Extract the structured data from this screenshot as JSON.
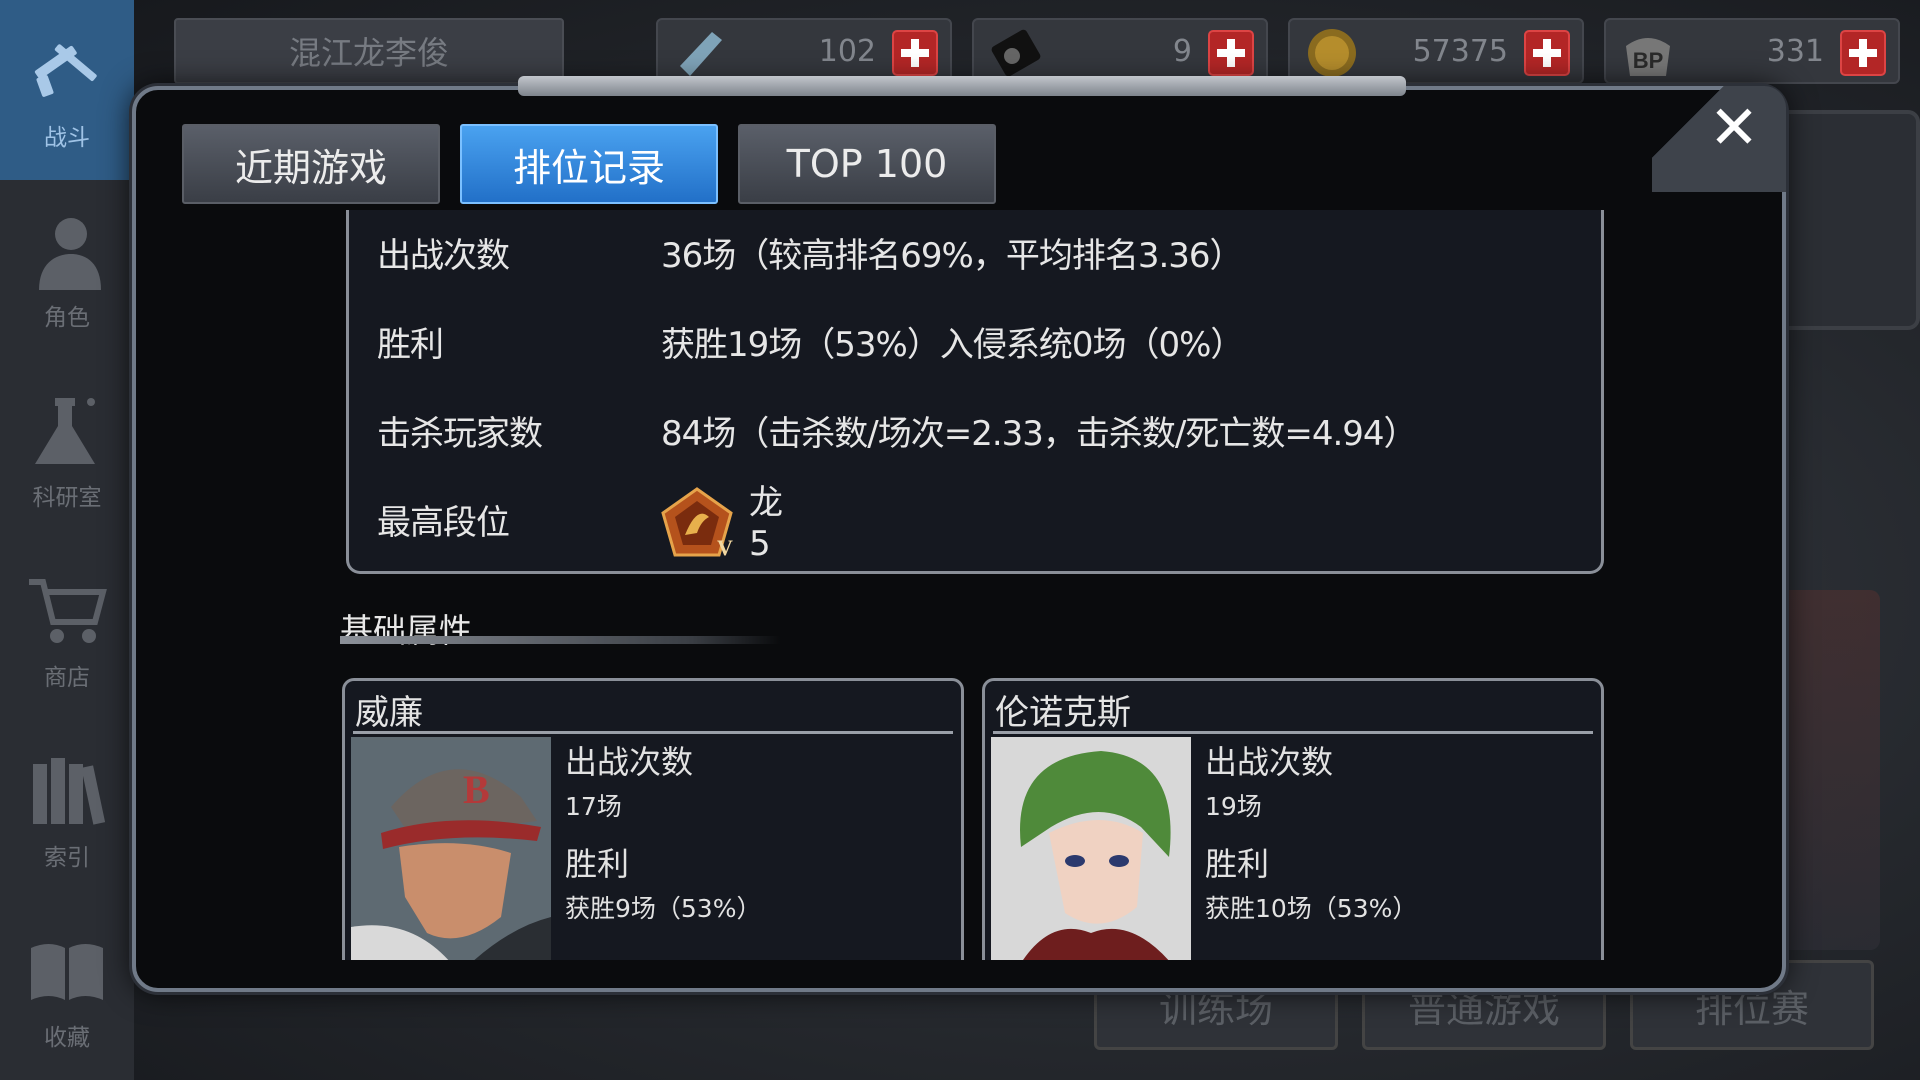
{
  "sidebar": {
    "items": [
      {
        "label": "战斗",
        "icon": "battle-guns-icon",
        "active": true
      },
      {
        "label": "角色",
        "icon": "character-icon",
        "active": false
      },
      {
        "label": "科研室",
        "icon": "lab-flask-icon",
        "active": false
      },
      {
        "label": "商店",
        "icon": "shopping-cart-icon",
        "active": false
      },
      {
        "label": "索引",
        "icon": "books-index-icon",
        "active": false
      },
      {
        "label": "收藏",
        "icon": "open-book-icon",
        "active": false
      }
    ]
  },
  "header": {
    "player_title": "混江龙李俊",
    "currencies": [
      {
        "icon": "crystal-icon",
        "value": "102"
      },
      {
        "icon": "ticket-disc-icon",
        "value": "9"
      },
      {
        "icon": "gold-coin-icon",
        "value": "57375"
      },
      {
        "icon": "bp-paw-icon",
        "value": "331"
      }
    ]
  },
  "background_buttons": [
    "训练场",
    "普通游戏",
    "排位赛"
  ],
  "modal": {
    "tabs": [
      {
        "label": "近期游戏",
        "active": false
      },
      {
        "label": "排位记录",
        "active": true
      },
      {
        "label": "TOP 100",
        "active": false
      }
    ],
    "close_symbol": "✕",
    "stats": [
      {
        "label": "出战次数",
        "value": "36场（较高排名69%，平均排名3.36）"
      },
      {
        "label": "胜利",
        "value": "获胜19场（53%）入侵系统0场（0%）"
      },
      {
        "label": "击杀玩家数",
        "value": "84场（击杀数/场次=2.33，击杀数/死亡数=4.94）"
      },
      {
        "label": "最高段位",
        "value": "龙5",
        "badge_icon": "dragon-rank-badge-icon"
      }
    ],
    "section_title": "基础属性",
    "characters": [
      {
        "name": "威廉",
        "games_label": "出战次数",
        "games_value": "17场",
        "wins_label": "胜利",
        "wins_value": "获胜9场（53%）"
      },
      {
        "name": "伦诺克斯",
        "games_label": "出战次数",
        "games_value": "19场",
        "wins_label": "胜利",
        "wins_value": "获胜10场（53%）"
      }
    ]
  },
  "colors": {
    "tab_active": "#2f83dc",
    "sidebar_active": "#2f5c86",
    "plus_button": "#b32626"
  }
}
